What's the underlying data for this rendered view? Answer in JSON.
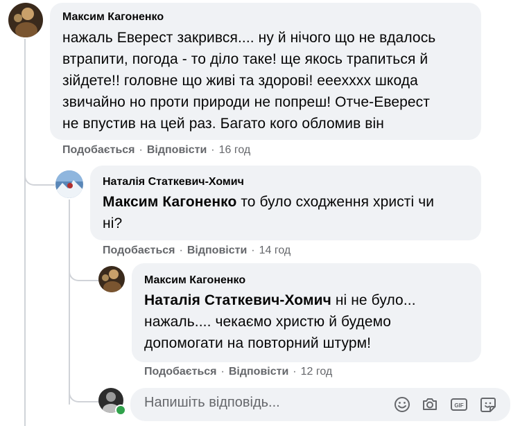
{
  "comment1": {
    "author": "Максим Кагоненко",
    "lines": [
      "нажаль Еверест закрився.... ну й нічого що не вдалось",
      "втрапити, погода - то діло таке! ще якось трапиться й",
      "зійдете!! головне що живі та здорові! eeexxxx шкода",
      "звичайно но проти природи не попреш! Отче-Еверест",
      "не впустив на цей раз. Багато кого обломив він"
    ],
    "like": "Подобається",
    "reply": "Відповісти",
    "time": "16 год"
  },
  "comment2": {
    "author": "Наталія Статкевич-Хомич",
    "mention": "Максим Кагоненко",
    "line1_rest": " то було сходження христі чи",
    "line2": "ні?",
    "like": "Подобається",
    "reply": "Відповісти",
    "time": "14 год"
  },
  "comment3": {
    "author": "Максим Кагоненко",
    "mention": "Наталія Статкевич-Хомич",
    "line1_rest": " ні не було...",
    "line2": "нажаль.... чекаємо христю й будемо",
    "line3": "допомогати на повторний штурм!",
    "like": "Подобається",
    "reply": "Відповісти",
    "time": "12 год"
  },
  "reply_box": {
    "placeholder": "Напишіть відповідь...",
    "icons": [
      "emoji-icon",
      "camera-icon",
      "gif-icon",
      "sticker-icon"
    ]
  },
  "separator": "·",
  "colors": {
    "bubble": "#f0f2f5",
    "meta": "#65676b",
    "text": "#050505",
    "online": "#31a24c"
  }
}
